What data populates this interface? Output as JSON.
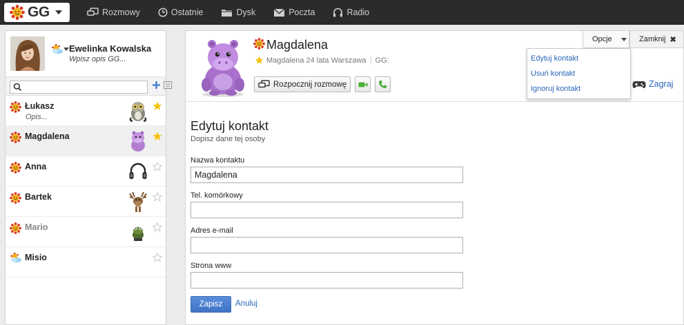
{
  "topbar": {
    "logo": "GG",
    "nav": [
      {
        "label": "Rozmowy",
        "icon": "chat-icon"
      },
      {
        "label": "Ostatnie",
        "icon": "clock-icon"
      },
      {
        "label": "Dysk",
        "icon": "folder-icon"
      },
      {
        "label": "Poczta",
        "icon": "mail-icon"
      },
      {
        "label": "Radio",
        "icon": "headphones-icon"
      }
    ]
  },
  "profile": {
    "name": "Ewelinka Kowalska",
    "description": "Wpisz opis GG..."
  },
  "search": {
    "placeholder": ""
  },
  "contacts": [
    {
      "name": "Łukasz",
      "description": "Opis...",
      "status": "available",
      "favorite": true
    },
    {
      "name": "Magdalena",
      "description": "",
      "status": "available",
      "favorite": true
    },
    {
      "name": "Anna",
      "description": "",
      "status": "available",
      "favorite": false
    },
    {
      "name": "Bartek",
      "description": "",
      "status": "available",
      "favorite": false
    },
    {
      "name": "Mario",
      "description": "",
      "status": "available",
      "favorite": false
    },
    {
      "name": "Misio",
      "description": "",
      "status": "away",
      "favorite": false
    }
  ],
  "conversation": {
    "name": "Magdalena",
    "info": "Magdalena 24 lata Warszawa",
    "gg_label": "GG:",
    "start_chat": "Rozpocznij rozmowę",
    "options_label": "Opcje",
    "close_label": "Zamknij",
    "game_label": "Zagraj",
    "options_menu": [
      "Edytuj kontakt",
      "Usuń kontakt",
      "Ignoruj kontakt"
    ]
  },
  "form": {
    "title": "Edytuj kontakt",
    "subtitle": "Dopisz dane tej osoby",
    "fields": [
      {
        "label": "Nazwa kontaktu",
        "value": "Magdalena"
      },
      {
        "label": "Tel. komórkowy",
        "value": ""
      },
      {
        "label": "Adres e-mail",
        "value": ""
      },
      {
        "label": "Strona www",
        "value": ""
      }
    ],
    "save_label": "Zapisz",
    "cancel_label": "Anuluj"
  },
  "colors": {
    "topbar": "#2b2b2b",
    "link": "#2a66b8",
    "primary_button": "#4a80d2",
    "sun": "#f0a21c",
    "petal": "#d83a1e"
  }
}
